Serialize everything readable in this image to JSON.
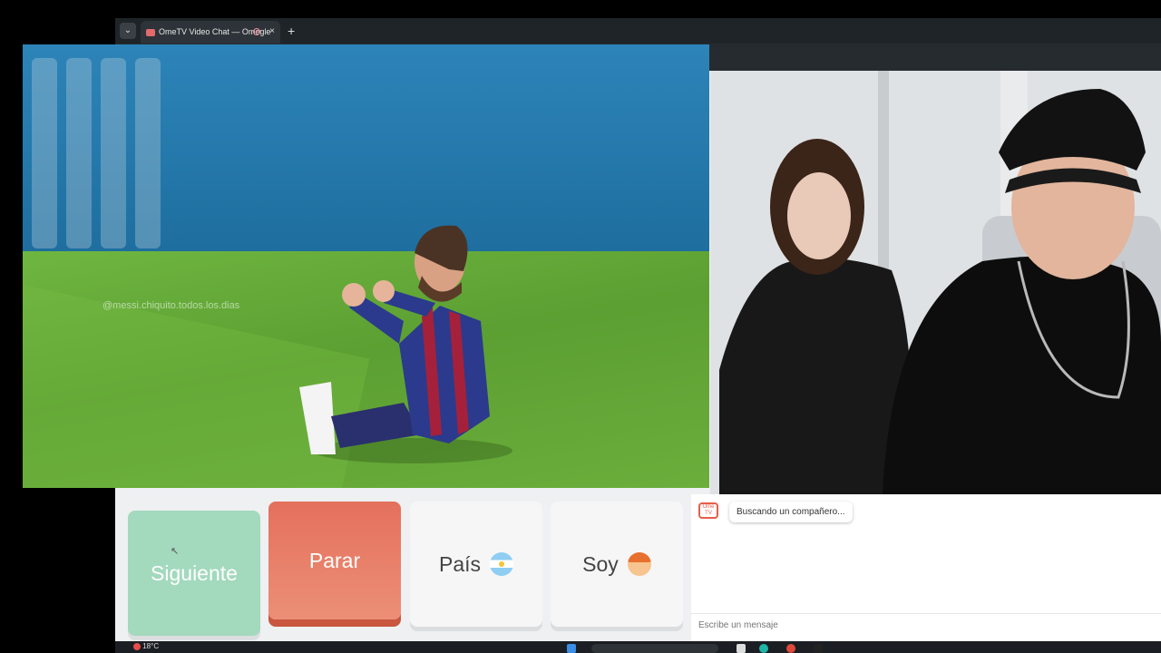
{
  "browser": {
    "tab_menu_icon": "chevron-down-icon",
    "tab_title": "OmeTV Video Chat — Omegle",
    "tab_close": "×",
    "new_tab": "+"
  },
  "left_video": {
    "watermark": "@messi.chiquito.todos.los.dias"
  },
  "controls": {
    "next_label": "Siguiente",
    "stop_label": "Parar",
    "country_label": "País",
    "country_flag_icon": "argentina-flag-icon",
    "gender_label": "Soy",
    "gender_icon": "boy-face-icon"
  },
  "chat": {
    "logo_text": "Ome TV",
    "status_message": "Buscando un compañero...",
    "input_placeholder": "Escribe un mensaje"
  },
  "taskbar": {
    "temperature": "18°C"
  },
  "colors": {
    "next_button": "#a3d9bd",
    "stop_button": "#e4705c",
    "tab_strip": "#1f2428"
  }
}
